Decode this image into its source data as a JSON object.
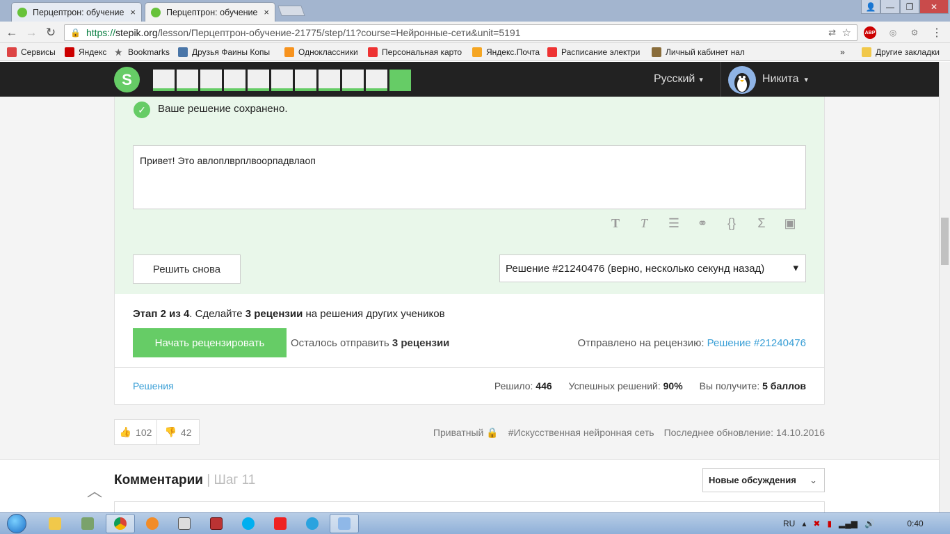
{
  "browser": {
    "tabs": [
      {
        "title": "Перцептрон: обучение",
        "close": "×"
      },
      {
        "title": "Перцептрон: обучение",
        "close": "×"
      }
    ],
    "window_controls": [
      "—",
      "❐",
      "✕"
    ],
    "url_prefix": "https://",
    "url_host": "stepik.org",
    "url_rest": "/lesson/Перцептрон-обучение-21775/step/11?course=Нейронные-сети&unit=5191",
    "bookmarks": [
      {
        "label": "Сервисы",
        "color": "#d44"
      },
      {
        "label": "Яндекс",
        "color": "#c00"
      },
      {
        "label": "Bookmarks",
        "color": "#666"
      },
      {
        "label": "Друзья Фаины Копы",
        "color": "#4a76a8"
      },
      {
        "label": "Одноклассники",
        "color": "#f7931e"
      },
      {
        "label": "Персональная карто",
        "color": "#e33"
      },
      {
        "label": "Яндекс.Почта",
        "color": "#f5a623"
      },
      {
        "label": "Расписание электри",
        "color": "#e33"
      },
      {
        "label": "Личный кабинет нал",
        "color": "#8a6d3b"
      }
    ],
    "bookmarks_more": "»",
    "other_bookmarks": "Другие закладки"
  },
  "header": {
    "language": "Русский",
    "user_name": "Никита",
    "step_count": 11
  },
  "step": {
    "saved_message": "Ваше решение сохранено.",
    "answer_text": "Привет! Это авлоплврплвоорпадвлаоп",
    "retry_label": "Решить снова",
    "submission_select": "Решение #21240476 (верно, несколько секунд назад)",
    "stage_prefix": "Этап 2 из 4",
    "stage_mid": ". Сделайте ",
    "stage_bold": "3 рецензии",
    "stage_suffix": " на решения других учеников",
    "start_review_label": "Начать рецензировать",
    "remain_prefix": "Осталось отправить ",
    "remain_bold": "3 рецензии",
    "sent_prefix": "Отправлено на рецензию: ",
    "sent_link": "Решение #21240476",
    "solutions_link": "Решения",
    "solved_label": "Решило: ",
    "solved_value": "446",
    "success_label": "Успешных решений: ",
    "success_value": "90%",
    "reward_label": "Вы получите: ",
    "reward_value": "5 баллов"
  },
  "feedback": {
    "likes": "102",
    "dislikes": "42",
    "private_label": "Приватный",
    "tag": "#Искусственная нейронная сеть",
    "updated": "Последнее обновление: 14.10.2016"
  },
  "comments": {
    "title": "Комментарии",
    "step_label": "| Шаг 11",
    "sort": "Новые обсуждения"
  },
  "taskbar": {
    "lang": "RU",
    "time": "0:40"
  }
}
